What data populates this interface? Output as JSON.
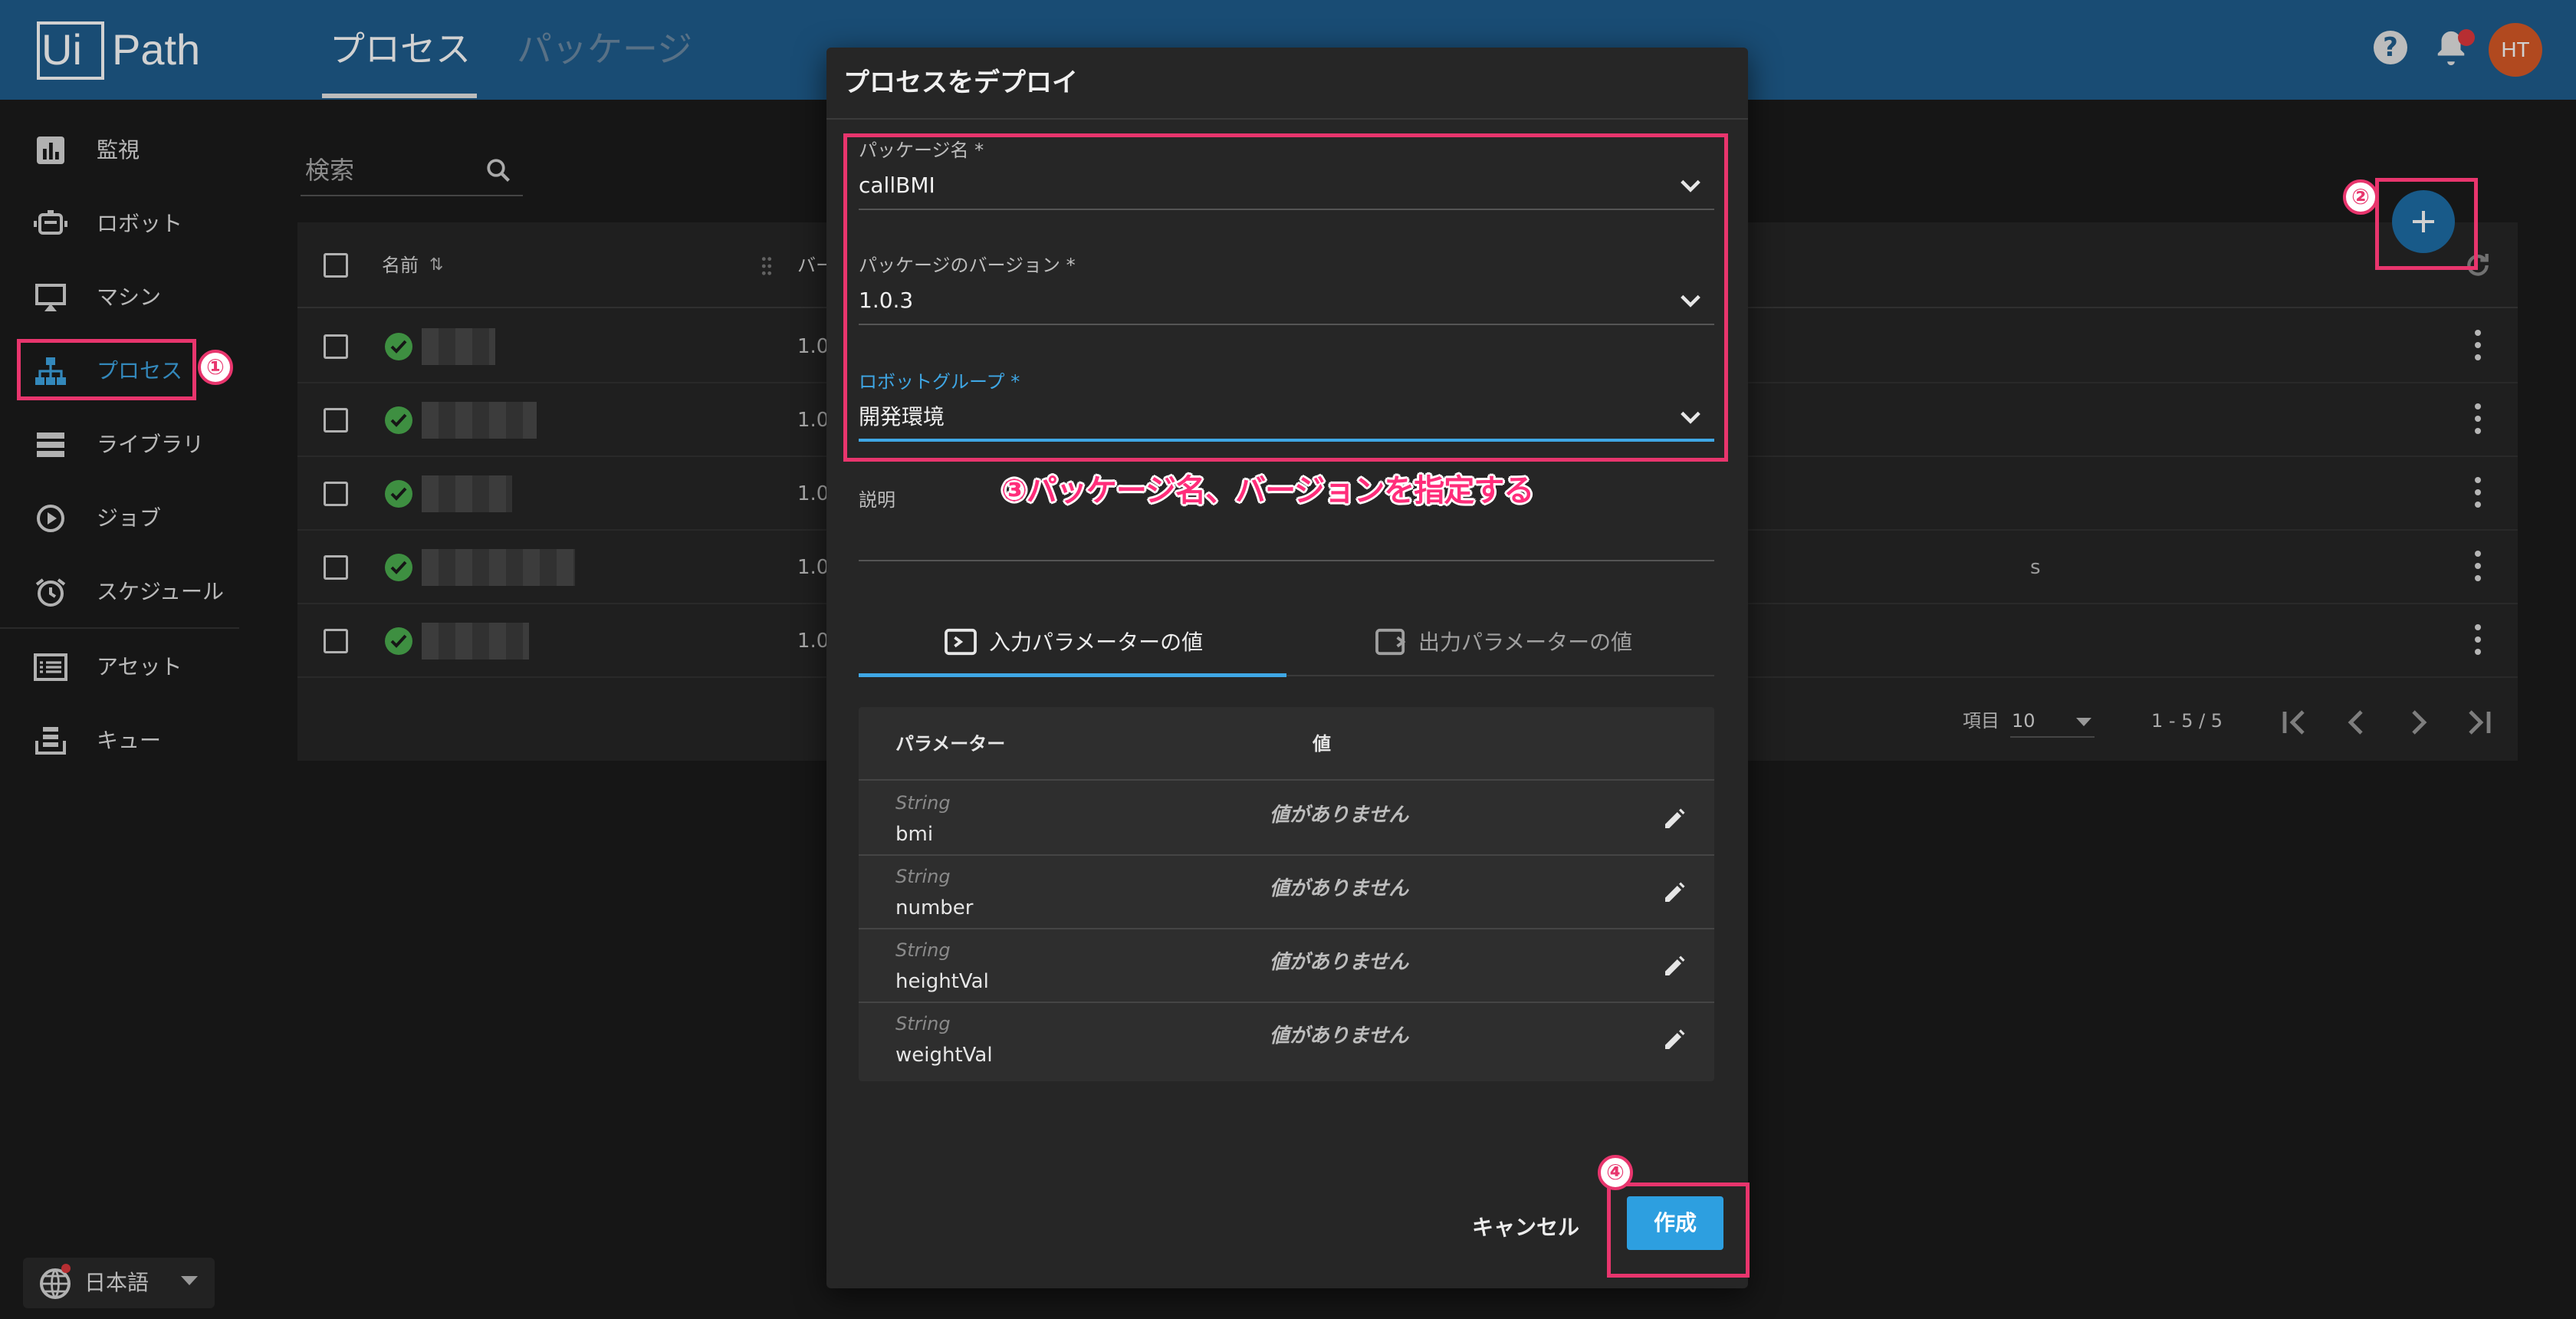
{
  "topbar": {
    "logo_ui": "Ui",
    "logo_path": "Path",
    "tabs": [
      {
        "label": "プロセス",
        "active": true
      },
      {
        "label": "パッケージ",
        "active": false
      }
    ],
    "avatar_initials": "HT",
    "icons": [
      "help-icon",
      "bell-icon"
    ]
  },
  "sidebar": {
    "items": [
      {
        "label": "監視",
        "icon": "chart-icon"
      },
      {
        "label": "ロボット",
        "icon": "robot-icon"
      },
      {
        "label": "マシン",
        "icon": "monitor-icon"
      },
      {
        "label": "プロセス",
        "icon": "org-tree-icon",
        "active": true
      },
      {
        "label": "ライブラリ",
        "icon": "library-icon"
      },
      {
        "label": "ジョブ",
        "icon": "play-circle-icon"
      },
      {
        "label": "スケジュール",
        "icon": "alarm-icon"
      },
      {
        "label": "アセット",
        "icon": "list-icon"
      },
      {
        "label": "キュー",
        "icon": "queue-icon"
      }
    ],
    "language": "日本語"
  },
  "main": {
    "search_placeholder": "検索",
    "table": {
      "col_name": "名前",
      "col_version": "バー",
      "rows": [
        {
          "version": "1.0",
          "trail": ""
        },
        {
          "version": "1.0",
          "trail": ""
        },
        {
          "version": "1.0",
          "trail": ""
        },
        {
          "version": "1.0",
          "trail": "s"
        },
        {
          "version": "1.0",
          "trail": ""
        }
      ]
    },
    "pager": {
      "items_label": "項目",
      "page_size": "10",
      "range": "1 - 5 / 5"
    }
  },
  "dialog": {
    "title": "プロセスをデプロイ",
    "package_name_label": "パッケージ名 *",
    "package_name_value": "callBMI",
    "package_version_label": "パッケージのバージョン *",
    "package_version_value": "1.0.3",
    "robot_group_label": "ロボットグループ *",
    "robot_group_value": "開発環境",
    "description_label": "説明",
    "tabs": [
      {
        "label": "入力パラメーターの値",
        "active": true
      },
      {
        "label": "出力パラメーターの値",
        "active": false
      }
    ],
    "params": {
      "header_param": "パラメーター",
      "header_value": "値",
      "rows": [
        {
          "type": "String",
          "name": "bmi",
          "value": "値がありません"
        },
        {
          "type": "String",
          "name": "number",
          "value": "値がありません"
        },
        {
          "type": "String",
          "name": "heightVal",
          "value": "値がありません"
        },
        {
          "type": "String",
          "name": "weightVal",
          "value": "値がありません"
        }
      ]
    },
    "cancel_label": "キャンセル",
    "create_label": "作成"
  },
  "annotations": {
    "step1": "①",
    "step2": "②",
    "step4": "④",
    "note3": "③パッケージ名、バージョンを指定する",
    "highlight_color": "#e8356d"
  }
}
